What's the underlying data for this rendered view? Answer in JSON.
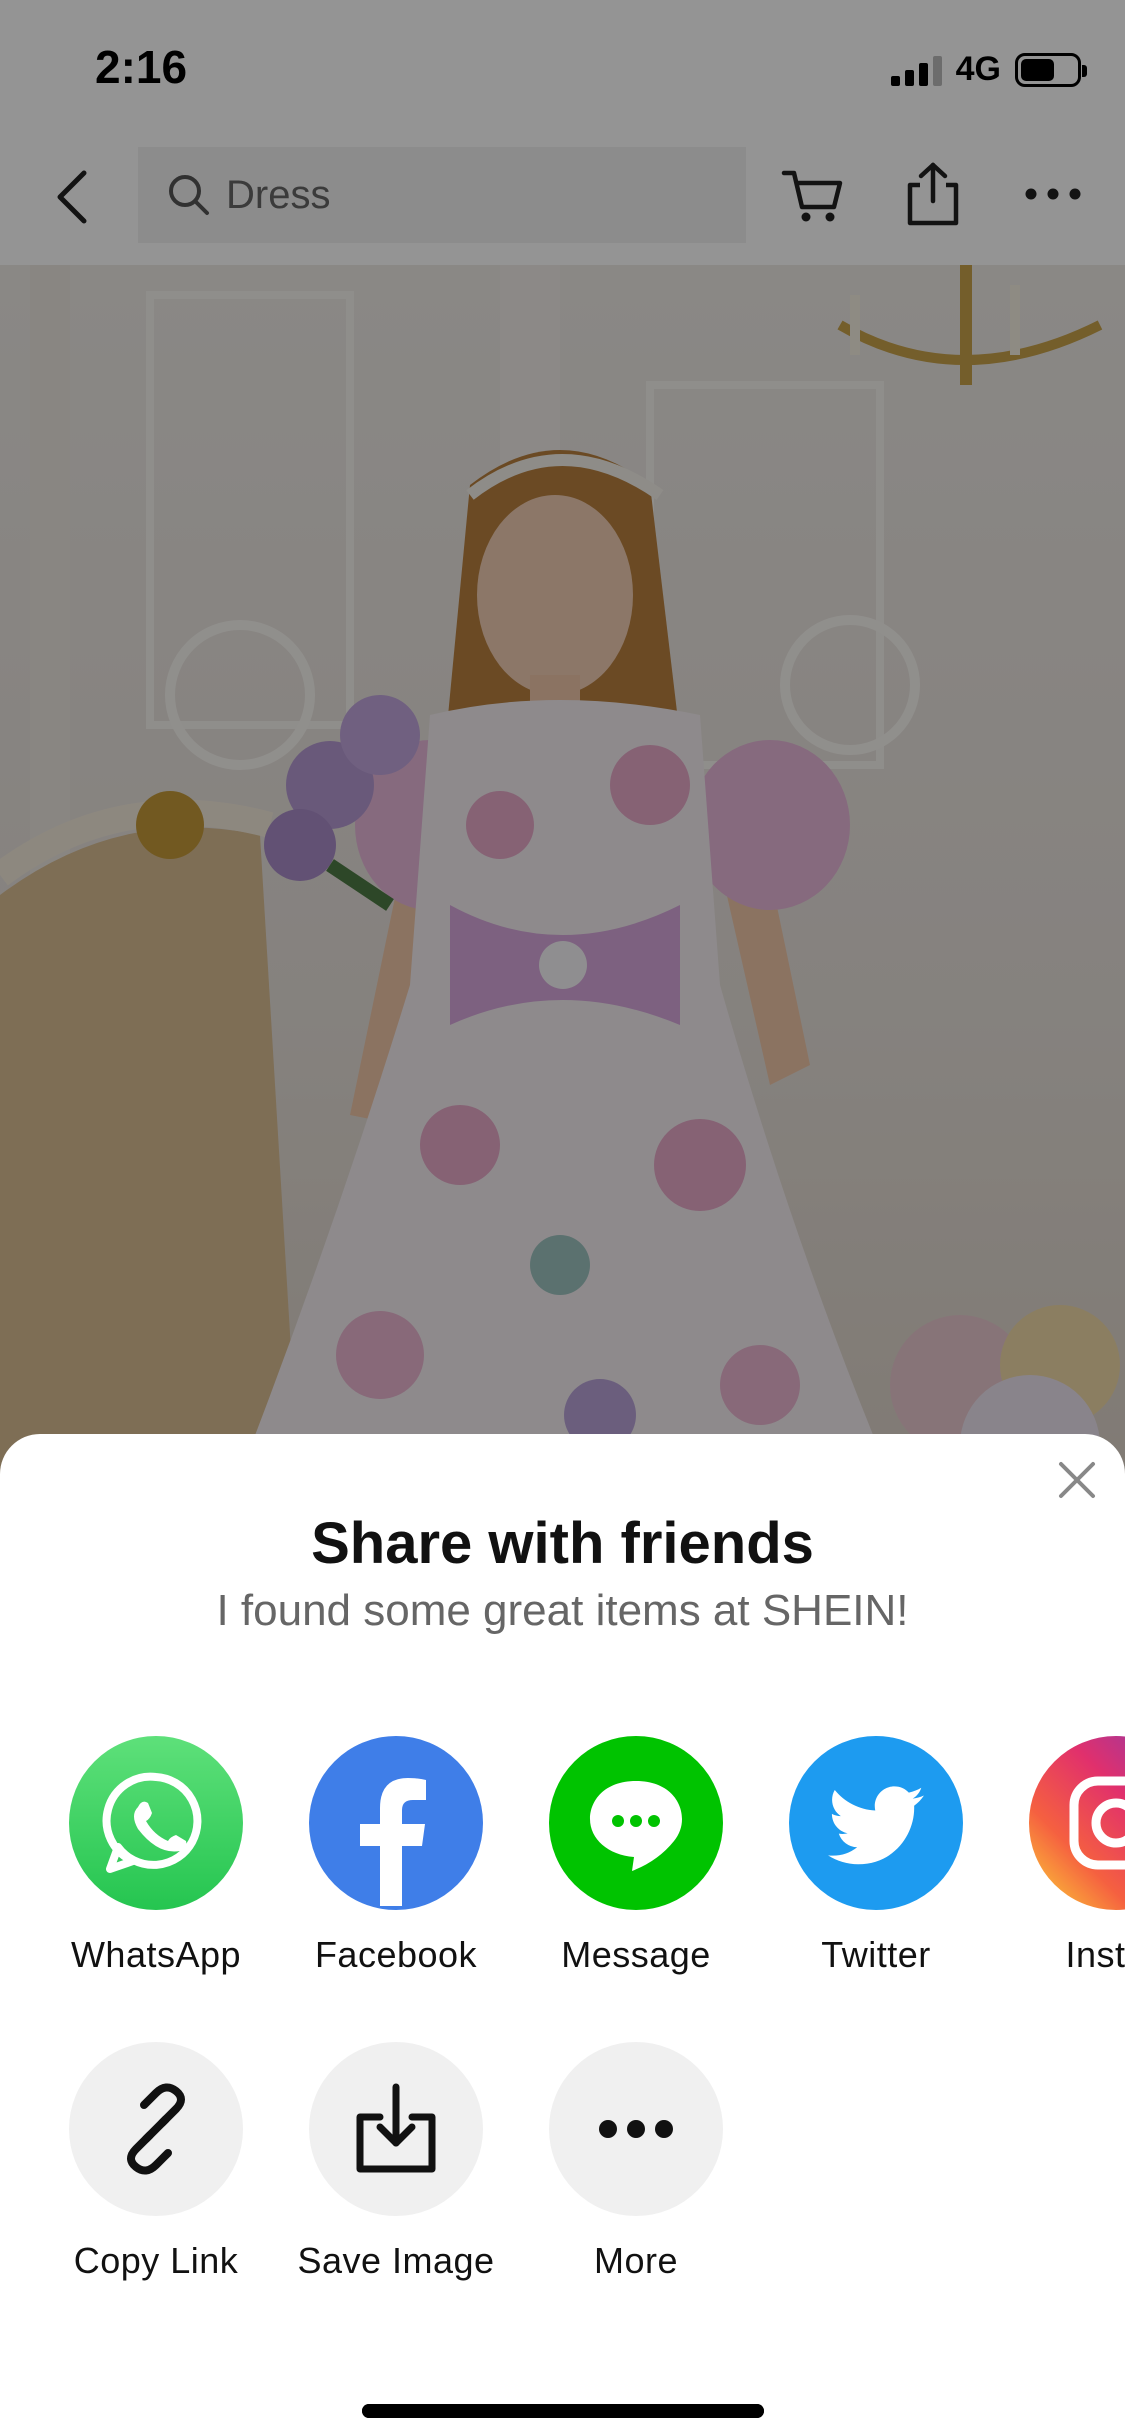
{
  "status_bar": {
    "time": "2:16",
    "network": "4G"
  },
  "nav": {
    "search_placeholder": "Dress"
  },
  "share_sheet": {
    "title": "Share with friends",
    "subtitle": "I found some great items at SHEIN!",
    "apps": [
      {
        "label": "WhatsApp",
        "icon": "whatsapp-icon",
        "color": "#25d366"
      },
      {
        "label": "Facebook",
        "icon": "facebook-icon",
        "color": "#3b82f6"
      },
      {
        "label": "Message",
        "icon": "message-icon",
        "color": "#00c300"
      },
      {
        "label": "Twitter",
        "icon": "twitter-icon",
        "color": "#1d9bf0"
      },
      {
        "label": "Instag",
        "icon": "instagram-icon",
        "color": "#e1306c"
      }
    ],
    "actions": [
      {
        "label": "Copy Link",
        "icon": "link-icon"
      },
      {
        "label": "Save Image",
        "icon": "download-icon"
      },
      {
        "label": "More",
        "icon": "more-icon"
      }
    ]
  }
}
